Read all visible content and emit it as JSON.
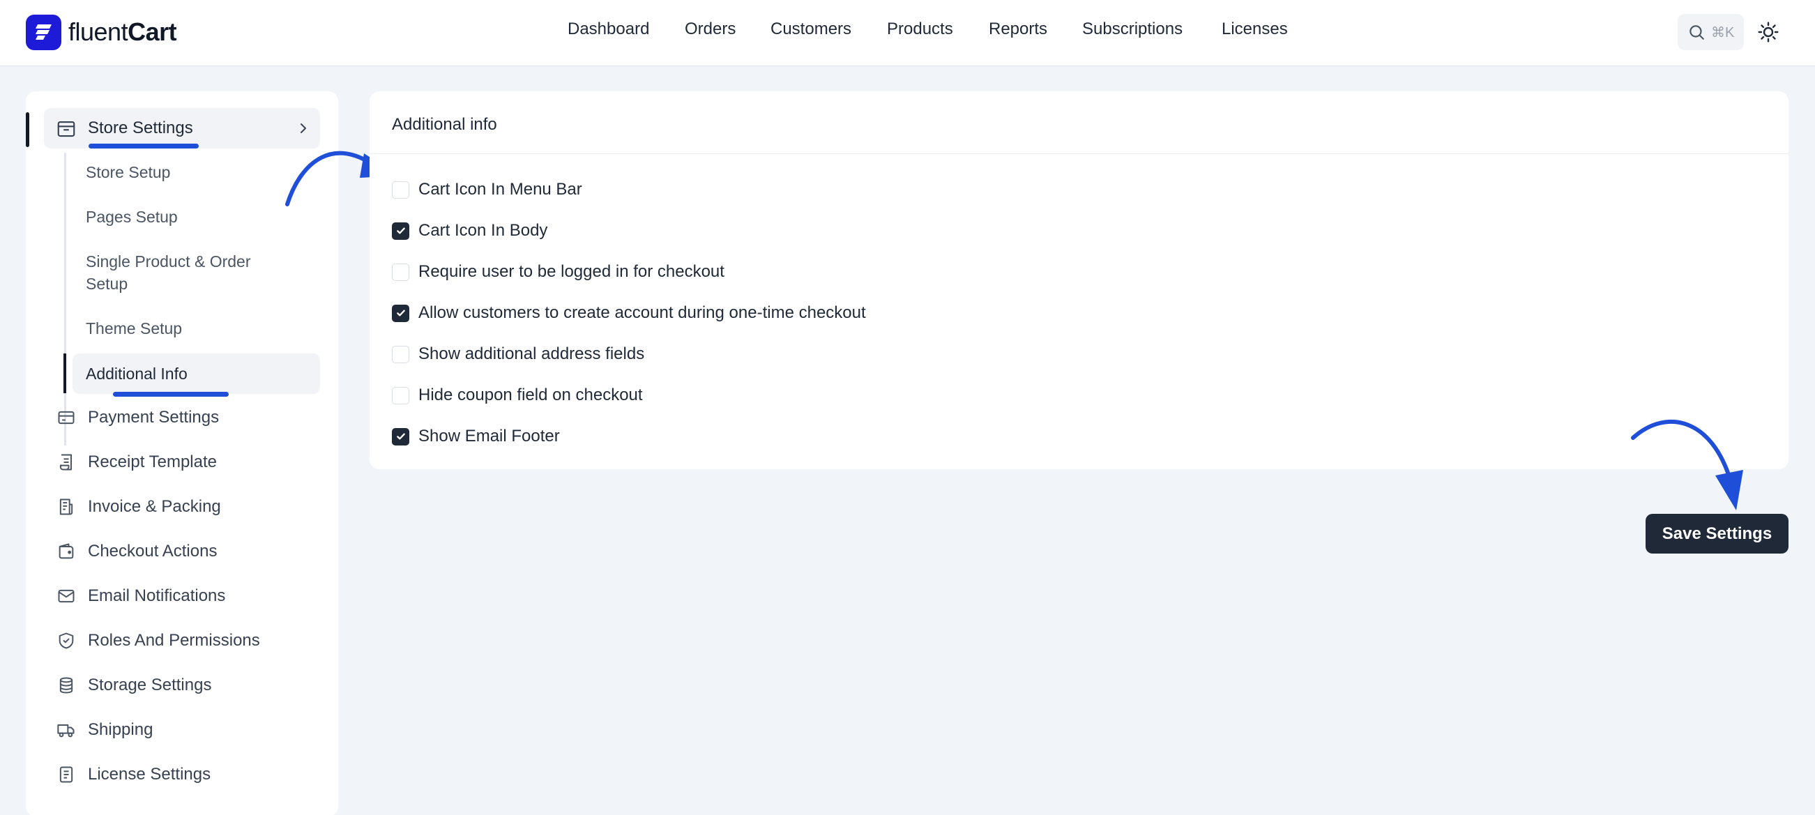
{
  "brand": {
    "light": "fluent",
    "bold": "Cart",
    "color": "#1d1ad8"
  },
  "nav": {
    "items": [
      {
        "label": "Dashboard"
      },
      {
        "label": "Orders"
      },
      {
        "label": "Customers"
      },
      {
        "label": "Products"
      },
      {
        "label": "Reports"
      },
      {
        "label": "Subscriptions"
      },
      {
        "label": "Licenses"
      }
    ],
    "search_shortcut": "⌘K"
  },
  "sidebar": {
    "header": {
      "label": "Store Settings",
      "icon": "store-icon"
    },
    "sub_items": [
      {
        "label": "Store Setup"
      },
      {
        "label": "Pages Setup"
      },
      {
        "label": "Single Product & Order Setup"
      },
      {
        "label": "Theme Setup"
      },
      {
        "label": "Additional Info",
        "active": true
      }
    ],
    "items": [
      {
        "label": "Payment Settings",
        "icon": "credit-card-icon"
      },
      {
        "label": "Receipt Template",
        "icon": "receipt-icon"
      },
      {
        "label": "Invoice & Packing",
        "icon": "invoice-icon"
      },
      {
        "label": "Checkout Actions",
        "icon": "wallet-icon"
      },
      {
        "label": "Email Notifications",
        "icon": "mail-icon"
      },
      {
        "label": "Roles And Permissions",
        "icon": "shield-icon"
      },
      {
        "label": "Storage Settings",
        "icon": "database-icon"
      },
      {
        "label": "Shipping",
        "icon": "truck-icon"
      },
      {
        "label": "License Settings",
        "icon": "document-icon"
      }
    ]
  },
  "main": {
    "title": "Additional info",
    "options": [
      {
        "label": "Cart Icon In Menu Bar",
        "checked": false
      },
      {
        "label": "Cart Icon In Body",
        "checked": true
      },
      {
        "label": "Require user to be logged in for checkout",
        "checked": false
      },
      {
        "label": "Allow customers to create account during one-time checkout",
        "checked": true
      },
      {
        "label": "Show additional address fields",
        "checked": false
      },
      {
        "label": "Hide coupon field on checkout",
        "checked": false
      },
      {
        "label": "Show Email Footer",
        "checked": true
      }
    ],
    "save_label": "Save Settings"
  },
  "colors": {
    "accent": "#1f4fd8",
    "dark": "#1f2937",
    "background": "#f1f4f9"
  }
}
